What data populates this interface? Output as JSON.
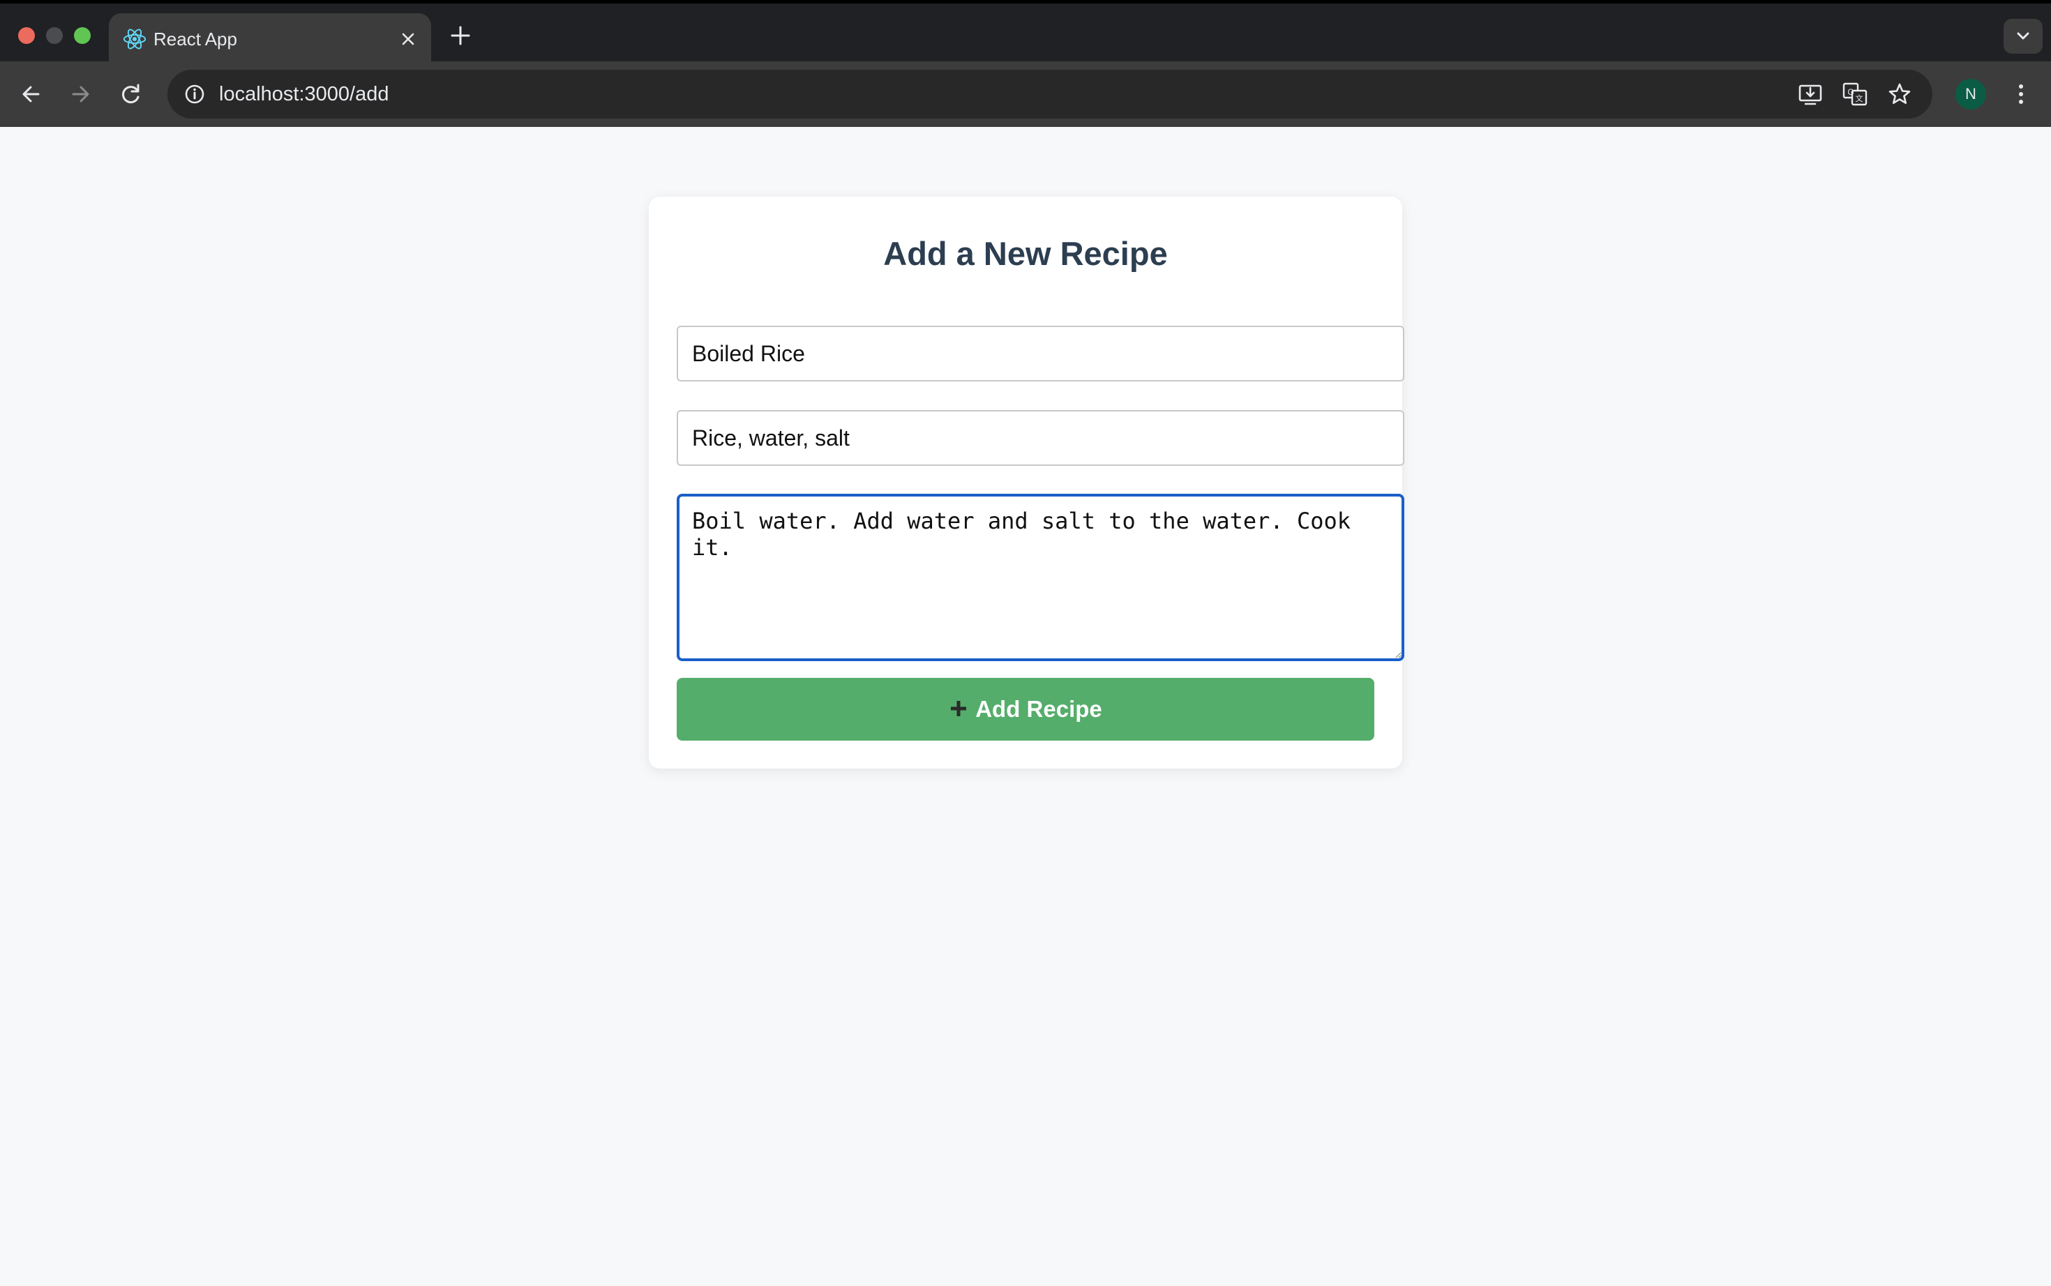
{
  "browser": {
    "tab_title": "React App",
    "url": "localhost:3000/add",
    "profile_initial": "N"
  },
  "page": {
    "title": "Add a New Recipe",
    "form": {
      "name_value": "Boiled Rice",
      "ingredients_value": "Rice, water, salt",
      "instructions_value": "Boil water. Add water and salt to the water. Cook it.",
      "submit_label": "Add Recipe",
      "submit_icon": "plus-icon"
    }
  },
  "colors": {
    "accent_button": "#55ad6b",
    "focus_ring": "#1a5fc9",
    "title_text": "#2c3e50"
  }
}
